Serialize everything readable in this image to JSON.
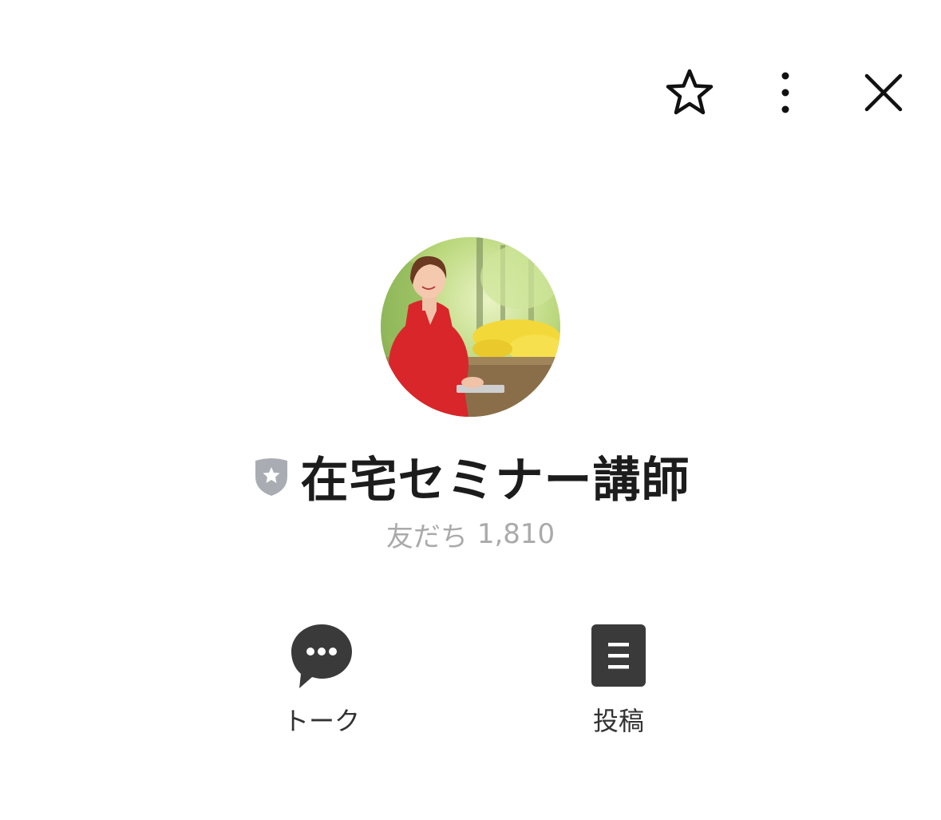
{
  "header": {
    "favorite_icon": "star-outline-icon",
    "more_icon": "vertical-dots-icon",
    "close_icon": "close-x-icon"
  },
  "profile": {
    "avatar_alt": "profile-photo",
    "badge_icon": "verified-shield-star-icon",
    "name": "在宅セミナー講師",
    "friends_label": "友だち",
    "friends_count": "1,810"
  },
  "actions": [
    {
      "label": "トーク",
      "icon": "chat-bubble-icon"
    },
    {
      "label": "投稿",
      "icon": "post-document-icon"
    }
  ],
  "colors": {
    "icon_dark": "#3a3a3a",
    "badge_gray": "#a9adb3",
    "muted_text": "#aaaaaa",
    "dress_red": "#d8262b"
  }
}
